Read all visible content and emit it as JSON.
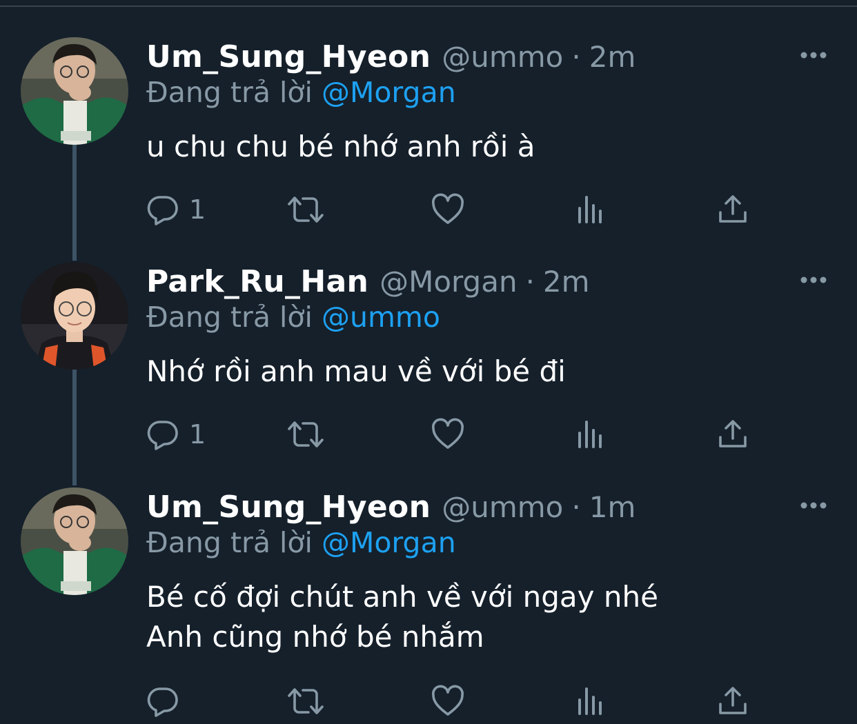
{
  "tweets": [
    {
      "display_name": "Um_Sung_Hyeon",
      "handle": "@ummo",
      "separator": "·",
      "time": "2m",
      "reply_prefix": "Đang trả lời",
      "reply_to": "@Morgan",
      "text": "u chu chu bé nhớ anh rồi à",
      "reply_count": "1",
      "avatar": "avatar-photo-um-sung-hyeon"
    },
    {
      "display_name": "Park_Ru_Han",
      "handle": "@Morgan",
      "separator": "·",
      "time": "2m",
      "reply_prefix": "Đang trả lời",
      "reply_to": "@ummo",
      "text": "Nhớ rồi anh mau về với bé đi",
      "reply_count": "1",
      "avatar": "avatar-photo-park-ru-han"
    },
    {
      "display_name": "Um_Sung_Hyeon",
      "handle": "@ummo",
      "separator": "·",
      "time": "1m",
      "reply_prefix": "Đang trả lời",
      "reply_to": "@Morgan",
      "text_line1": "Bé cố đợi chút anh về với ngay nhé",
      "text_line2": "Anh cũng nhớ bé nhắm",
      "reply_count": "",
      "avatar": "avatar-photo-um-sung-hyeon"
    }
  ],
  "icons": [
    "reply-icon",
    "retweet-icon",
    "like-icon",
    "stats-icon",
    "share-icon",
    "more-icon"
  ],
  "colors": {
    "background": "#15202b",
    "text": "#ffffff",
    "muted": "#8899a6",
    "mention": "#1da1f2",
    "thread_line": "#3d5466"
  }
}
